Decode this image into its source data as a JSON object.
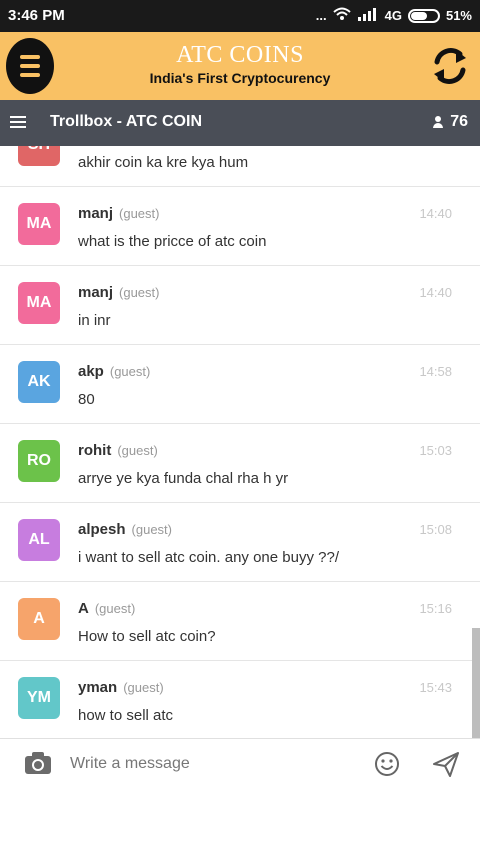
{
  "status": {
    "time": "3:46 PM",
    "dots": "...",
    "network": "4G",
    "battery": "51%"
  },
  "header": {
    "title": "ATC COINS",
    "subtitle": "India's First Cryptocurency"
  },
  "trollbox": {
    "title": "Trollbox - ATC COIN",
    "user_count": "76"
  },
  "messages": [
    {
      "initials": "SH",
      "color": "#e06666",
      "name": "",
      "role": "",
      "time": "",
      "text": "akhir coin ka kre kya hum"
    },
    {
      "initials": "MA",
      "color": "#f26b9b",
      "name": "manj",
      "role": "(guest)",
      "time": "14:40",
      "text": "what is the pricce of atc coin"
    },
    {
      "initials": "MA",
      "color": "#f26b9b",
      "name": "manj",
      "role": "(guest)",
      "time": "14:40",
      "text": "in inr"
    },
    {
      "initials": "AK",
      "color": "#5aa5e0",
      "name": "akp",
      "role": "(guest)",
      "time": "14:58",
      "text": "80"
    },
    {
      "initials": "RO",
      "color": "#6cc24a",
      "name": "rohit",
      "role": "(guest)",
      "time": "15:03",
      "text": "arrye ye kya funda chal rha h yr"
    },
    {
      "initials": "AL",
      "color": "#c77ddf",
      "name": "alpesh",
      "role": "(guest)",
      "time": "15:08",
      "text": "i want to sell atc coin. any one buyy ??/"
    },
    {
      "initials": "A",
      "color": "#f6a46b",
      "name": "A",
      "role": "(guest)",
      "time": "15:16",
      "text": "How to sell atc coin?"
    },
    {
      "initials": "YM",
      "color": "#62c7c9",
      "name": "yman",
      "role": "(guest)",
      "time": "15:43",
      "text": "how to sell atc"
    }
  ],
  "composer": {
    "placeholder": "Write a message"
  },
  "icons": {
    "menu": "menu-icon",
    "refresh": "refresh-icon",
    "hamburger": "hamburger-icon",
    "users": "user-icon",
    "camera": "camera-icon",
    "smiley": "smiley-icon",
    "send": "send-icon"
  },
  "colors": {
    "header_bg": "#f9c164",
    "toolbar_bg": "#4a4e57",
    "status_bg": "#1a1a1a"
  }
}
